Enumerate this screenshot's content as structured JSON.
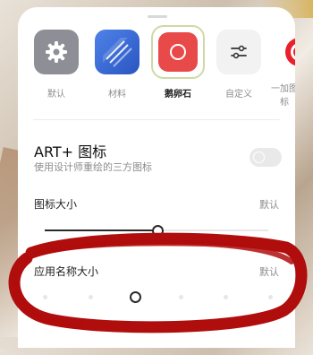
{
  "icon_styles": {
    "items": [
      {
        "label": "默认",
        "icon": "gear-icon",
        "color": "#8e8e96"
      },
      {
        "label": "材料",
        "icon": "stacked-layers-icon",
        "color": "#3b6fd6"
      },
      {
        "label": "鹅卵石",
        "icon": "pebble-ring-icon",
        "color": "#e84a4a"
      },
      {
        "label": "自定义",
        "icon": "sliders-icon",
        "color": "#f2f2f2"
      },
      {
        "label": "一加图标",
        "icon": "oneplus-icon",
        "color": "#e8202a"
      }
    ],
    "selected_index": 2
  },
  "art_plus": {
    "title": "ART+ 图标",
    "subtitle": "使用设计师重绘的三方图标",
    "enabled": false
  },
  "icon_size": {
    "label": "图标大小",
    "value_label": "默认",
    "level": 0.5
  },
  "app_name_size": {
    "label": "应用名称大小",
    "value_label": "默认",
    "steps": 7,
    "selected_step": 2
  },
  "annotation_color": "#b00d0d"
}
